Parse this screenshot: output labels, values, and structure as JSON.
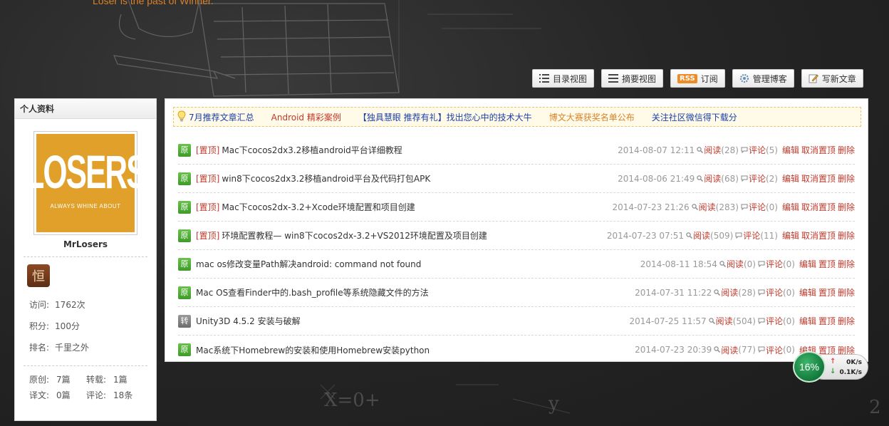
{
  "header": {
    "slogan": "Loser is the past of Winner."
  },
  "toolbar": {
    "buttons": [
      {
        "label": "目录视图",
        "icon": "list-icon"
      },
      {
        "label": "摘要视图",
        "icon": "summary-list-icon"
      },
      {
        "label": "订阅",
        "icon": "rss-icon",
        "badge": "RSS"
      },
      {
        "label": "管理博客",
        "icon": "gear-icon"
      },
      {
        "label": "写新文章",
        "icon": "edit-icon"
      }
    ]
  },
  "sidebar": {
    "title": "个人资料",
    "avatar": {
      "big_text": "LOSERS",
      "small_text": "ALWAYS WHINE ABOUT"
    },
    "username": "MrLosers",
    "medal_glyph": "恒",
    "stats": [
      {
        "label": "访问:",
        "value": "1762次"
      },
      {
        "label": "积分:",
        "value": "100分"
      },
      {
        "label": "排名:",
        "value": "千里之外"
      }
    ],
    "counts": [
      [
        {
          "label": "原创:",
          "value": "7篇"
        },
        {
          "label": "转载:",
          "value": "1篇"
        }
      ],
      [
        {
          "label": "译文:",
          "value": "0篇"
        },
        {
          "label": "评论:",
          "value": "18条"
        }
      ]
    ]
  },
  "notice": {
    "links": [
      {
        "text": "7月推荐文章汇总",
        "color": "#1a3fa8"
      },
      {
        "text": "Android 精彩案例",
        "color": "#c0392b"
      },
      {
        "text": "【独具慧眼 推荐有礼】找出您心中的技术大牛",
        "color": "#1a3fa8"
      },
      {
        "text": "博文大赛获奖名单公布",
        "color": "#d9822b"
      },
      {
        "text": "关注社区微信得下载分",
        "color": "#1a3fa8"
      }
    ]
  },
  "articles_labels": {
    "read": "阅读",
    "comment": "评论",
    "edit": "编辑",
    "unpin": "取消置顶",
    "pin": "置顶",
    "delete": "删除"
  },
  "articles": [
    {
      "type": "原",
      "kind": "orig",
      "pinned": "[置顶]",
      "title": "Mac下cocos2dx3.2移植android平台详细教程",
      "date": "2014-08-07 12:11",
      "reads": "(28)",
      "comments": "(5)",
      "actions": [
        "编辑",
        "取消置顶",
        "删除"
      ]
    },
    {
      "type": "原",
      "kind": "orig",
      "pinned": "[置顶]",
      "title": "win8下cocos2dx3.2移植android平台及代码打包APK",
      "date": "2014-08-06 21:49",
      "reads": "(68)",
      "comments": "(2)",
      "actions": [
        "编辑",
        "取消置顶",
        "删除"
      ]
    },
    {
      "type": "原",
      "kind": "orig",
      "pinned": "[置顶]",
      "title": "Mac下cocos2dx-3.2+Xcode环境配置和项目创建",
      "date": "2014-07-23 21:26",
      "reads": "(283)",
      "comments": "(0)",
      "actions": [
        "编辑",
        "取消置顶",
        "删除"
      ]
    },
    {
      "type": "原",
      "kind": "orig",
      "pinned": "[置顶]",
      "title": "环境配置教程— win8下cocos2dx-3.2+VS2012环境配置及项目创建",
      "date": "2014-07-23 07:51",
      "reads": "(509)",
      "comments": "(11)",
      "actions": [
        "编辑",
        "取消置顶",
        "删除"
      ]
    },
    {
      "type": "原",
      "kind": "orig",
      "pinned": "",
      "title": "mac os修改变量Path解决android: command not found",
      "date": "2014-08-11 18:54",
      "reads": "(0)",
      "comments": "(0)",
      "actions": [
        "编辑",
        "置顶",
        "删除"
      ]
    },
    {
      "type": "原",
      "kind": "orig",
      "pinned": "",
      "title": "Mac OS查看Finder中的.bash_profile等系统隐藏文件的方法",
      "date": "2014-07-31 11:22",
      "reads": "(28)",
      "comments": "(0)",
      "actions": [
        "编辑",
        "置顶",
        "删除"
      ]
    },
    {
      "type": "转",
      "kind": "repost",
      "pinned": "",
      "title": "Unity3D 4.5.2 安装与破解",
      "date": "2014-07-25 11:57",
      "reads": "(504)",
      "comments": "(0)",
      "actions": [
        "编辑",
        "置顶",
        "删除"
      ]
    },
    {
      "type": "原",
      "kind": "orig",
      "pinned": "",
      "title": "Mac系统下Homebrew的安装和使用Homebrew安装python",
      "date": "2014-07-23 20:39",
      "reads": "(77)",
      "comments": "(0)",
      "actions": [
        "编辑",
        "置顶",
        "删除"
      ]
    }
  ],
  "speed_widget": {
    "percent": "16%",
    "upload": "0K/s",
    "download": "0.1K/s"
  },
  "colors": {
    "accent_red": "#c0392b",
    "original_green": "#4caf32",
    "slogan_orange": "#d9822b"
  }
}
